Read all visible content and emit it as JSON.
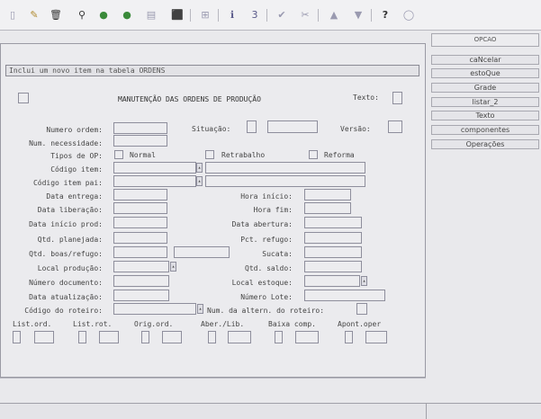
{
  "status_message": "Inclui um novo item na tabela ORDENS",
  "form": {
    "title": "MANUTENÇÃO DAS ORDENS DE PRODUÇÃO",
    "texto_label": "Texto:",
    "numero_ordem": "Numero ordem:",
    "situacao": "Situação:",
    "versao": "Versão:",
    "num_necessidade": "Num. necessidade:",
    "tipos_op": "Tipos de OP:",
    "normal": "Normal",
    "retrabalho": "Retrabalho",
    "reforma": "Reforma",
    "codigo_item": "Código item:",
    "codigo_item_pai": "Código item pai:",
    "data_entrega": "Data entrega:",
    "hora_inicio": "Hora início:",
    "data_liberacao": "Data liberação:",
    "hora_fim": "Hora fim:",
    "data_inicio_prod": "Data início prod:",
    "data_abertura": "Data abertura:",
    "qtd_planejada": "Qtd. planejada:",
    "pct_refugo": "Pct. refugo:",
    "qtd_boas_refugo": "Qtd. boas/refugo:",
    "sucata": "Sucata:",
    "local_producao": "Local produção:",
    "qtd_saldo": "Qtd. saldo:",
    "numero_documento": "Número documento:",
    "local_estoque": "Local estoque:",
    "data_atualizacao": "Data atualização:",
    "numero_lote": "Número Lote:",
    "codigo_roteiro": "Código do roteiro:",
    "num_altern_roteiro": "Num. da altern. do roteiro:"
  },
  "bottom_labels": [
    "List.ord.",
    "List.rot.",
    "Orig.ord.",
    "Aber./Lib.",
    "Baixa comp.",
    "Apont.oper"
  ],
  "sidebar": {
    "header": "OPCAO",
    "items": [
      "caNcelar",
      "estoQue",
      "Grade",
      "listar_2",
      "Texto",
      "componentes",
      "Operações"
    ]
  },
  "toolbar_icons": [
    "new-icon",
    "edit-icon",
    "delete-icon",
    "search-icon",
    "prev-icon",
    "next-icon",
    "print-icon",
    "exit-icon",
    "binoculars-icon",
    "info-icon",
    "three-icon",
    "confirm-icon",
    "cancel-icon",
    "up-icon",
    "down-icon",
    "help-icon",
    "comment-icon"
  ]
}
